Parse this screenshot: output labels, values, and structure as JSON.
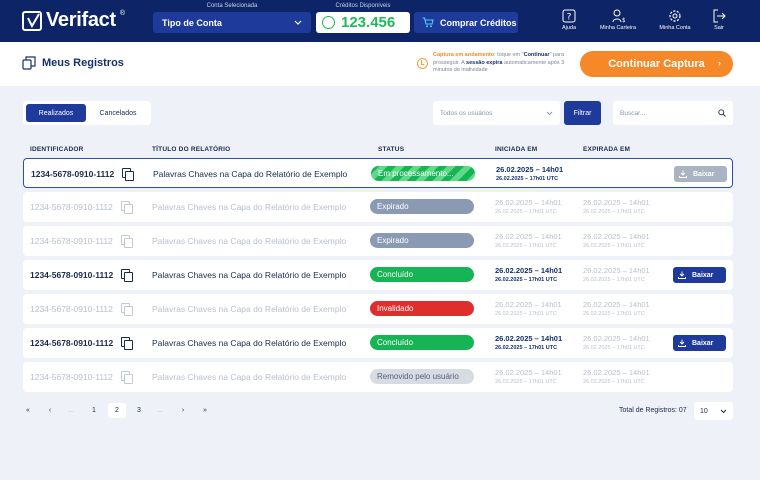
{
  "header": {
    "logo_text": "Verifact",
    "logo_mark": "®",
    "account_label": "Conta Selecionada",
    "account_value": "Tipo de Conta",
    "credits_label": "Créditos Disponíveis",
    "credits_value": "123.456",
    "buy_label": "Comprar Créditos",
    "nav": [
      {
        "label": "Ajuda",
        "icon": "help-icon"
      },
      {
        "label": "Minha Carteira",
        "icon": "wallet-icon"
      },
      {
        "label": "Minha Conta",
        "icon": "gear-icon"
      },
      {
        "label": "Sair",
        "icon": "logout-icon"
      }
    ]
  },
  "titlebar": {
    "title": "Meus Registros",
    "capture_note": {
      "highlight": "Captura em andamento",
      "p1": ": toque em \"",
      "cont": "Continuar",
      "p2": "\" para prosseguir. A ",
      "bold2": "sessão expira",
      "p3": " automaticamente após 3 minutos de inatividade"
    },
    "continue_label": "Continuar Captura"
  },
  "filters": {
    "tabs": [
      "Realizados",
      "Cancelados"
    ],
    "users_placeholder": "Todos os usuários",
    "filter_label": "Filtrar",
    "search_placeholder": "Buscar..."
  },
  "table": {
    "headers": [
      "IDENTIFICADOR",
      "TÍTULO DO RELATÓRIO",
      "STATUS",
      "INICIADA EM",
      "EXPIRADA EM"
    ],
    "download_label": "Baixar",
    "rows": [
      {
        "id": "1234-5678-0910-1112",
        "title": "Palavras Chaves na Capa do Relatório de Exemplo",
        "status": "Em processamento...",
        "started": "26.02.2025 – 14h01",
        "started_utc": "26.02.2025 – 17h01 UTC",
        "expired": "",
        "expired_utc": ""
      },
      {
        "id": "1234-5678-0910-1112",
        "title": "Palavras Chaves na Capa do Relatório de Exemplo",
        "status": "Expirado",
        "started": "26.02.2025 – 14h01",
        "started_utc": "26.02.2025 – 17h01 UTC",
        "expired": "26.02.2025 – 14h01",
        "expired_utc": "26.02.2025 – 17h01 UTC"
      },
      {
        "id": "1234-5678-0910-1112",
        "title": "Palavras Chaves na Capa do Relatório de Exemplo",
        "status": "Expirado",
        "started": "26.02.2025 – 14h01",
        "started_utc": "26.02.2025 – 17h01 UTC",
        "expired": "26.02.2025 – 14h01",
        "expired_utc": "26.02.2025 – 17h01 UTC"
      },
      {
        "id": "1234-5678-0910-1112",
        "title": "Palavras Chaves na Capa do Relatório de Exemplo",
        "status": "Concluído",
        "started": "26.02.2025 – 14h01",
        "started_utc": "26.02.2025 – 17h01 UTC",
        "expired": "26.02.2025 – 14h01",
        "expired_utc": "26.02.2025 – 17h01 UTC"
      },
      {
        "id": "1234-5678-0910-1112",
        "title": "Palavras Chaves na Capa do Relatório de Exemplo",
        "status": "Invalidado",
        "started": "26.02.2025 – 14h01",
        "started_utc": "26.02.2025 – 17h01 UTC",
        "expired": "26.02.2025 – 14h01",
        "expired_utc": "26.02.2025 – 17h01 UTC"
      },
      {
        "id": "1234-5678-0910-1112",
        "title": "Palavras Chaves na Capa do Relatório de Exemplo",
        "status": "Concluído",
        "started": "26.02.2025 – 14h01",
        "started_utc": "26.02.2025 – 17h01 UTC",
        "expired": "26.02.2025 – 14h01",
        "expired_utc": "26.02.2025 – 17h01 UTC"
      },
      {
        "id": "1234-5678-0910-1112",
        "title": "Palavras Chaves na Capa do Relatório de Exemplo",
        "status": "Removido pelo usuário",
        "started": "26.02.2025 – 14h01",
        "started_utc": "26.02.2025 – 17h01 UTC",
        "expired": "26.02.2025 – 14h01",
        "expired_utc": "26.02.2025 – 17h01 UTC"
      }
    ]
  },
  "pagination": {
    "first": "«",
    "prev": "‹",
    "ellipsis": "...",
    "pages": [
      "1",
      "2",
      "3"
    ],
    "current": "2",
    "next": "›",
    "last": "»",
    "total_label": "Total de Registros: 07",
    "per_page": "10"
  },
  "colors": {
    "header_bg": "#0d2466",
    "primary": "#1e3a9a",
    "accent_orange": "#f5892a",
    "success": "#17b455",
    "danger": "#df2e2e",
    "expired": "#8a9ab3"
  }
}
